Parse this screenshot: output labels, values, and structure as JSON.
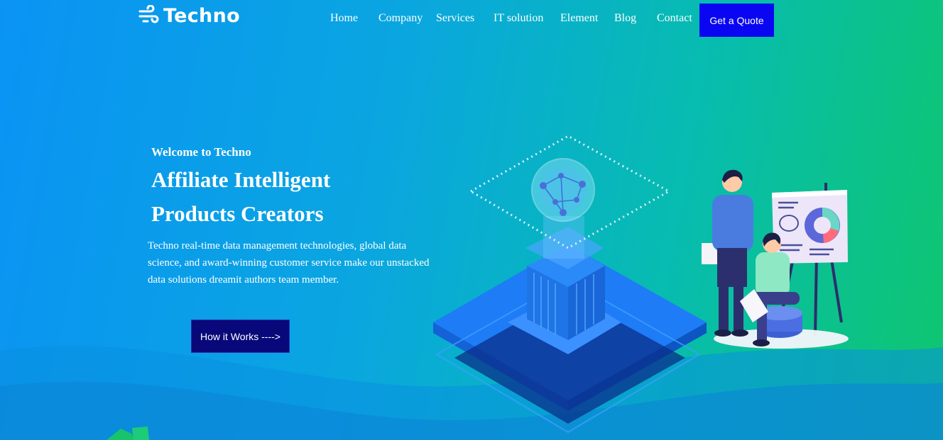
{
  "brand": {
    "name": "Techno"
  },
  "nav": {
    "items": [
      "Home",
      "Company",
      "Services",
      "IT solution",
      "Element",
      "Blog",
      "Contact"
    ],
    "cta_label": "Get a Quote"
  },
  "hero": {
    "welcome": "Welcome to Techno",
    "headline_line1": "Affiliate Intelligent",
    "headline_line2": "Products Creators",
    "description": "Techno real-time data management technologies, global data science, and award-winning customer service make our unstacked data solutions dreamit authors team member.",
    "button_label": "How it Works ---->"
  },
  "colors": {
    "gradient_start": "#0a93f4",
    "gradient_end": "#0fc66f",
    "cta_button": "#0a06f2",
    "hero_button": "#08087a"
  }
}
